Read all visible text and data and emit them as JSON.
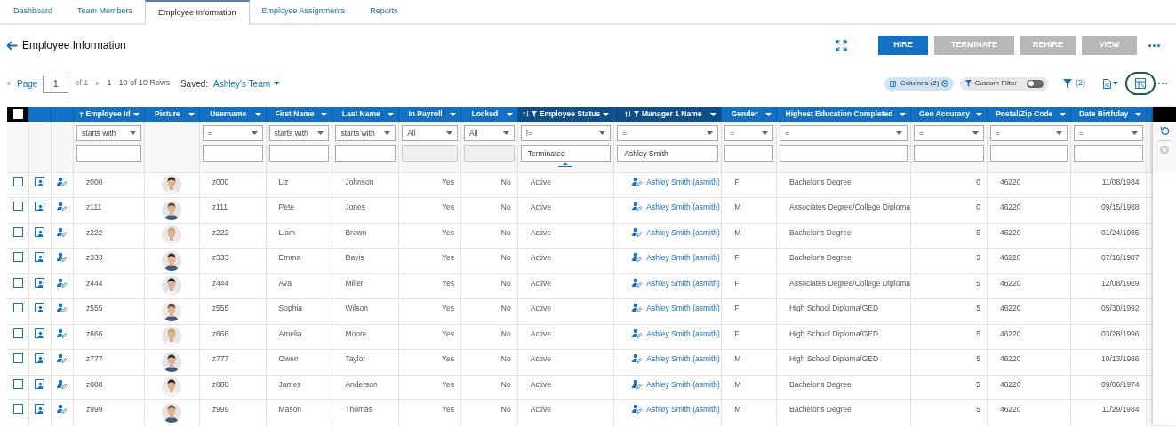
{
  "tabs": [
    {
      "label": "Dashboard",
      "selected": false
    },
    {
      "label": "Team Members",
      "selected": false
    },
    {
      "label": "Employee Information",
      "selected": true
    },
    {
      "label": "Employee Assignments",
      "selected": false
    },
    {
      "label": "Reports",
      "selected": false
    }
  ],
  "header": {
    "title": "Employee Information",
    "buttons": [
      {
        "label": "HIRE",
        "disabled": false
      },
      {
        "label": "TERMINATE",
        "disabled": true
      },
      {
        "label": "REHIRE",
        "disabled": true
      },
      {
        "label": "VIEW",
        "disabled": true
      }
    ]
  },
  "pager": {
    "page_label": "Page",
    "page": "1",
    "of": "of 1",
    "rows": "1 - 10 of 10 Rows",
    "saved_label": "Saved:",
    "saved": "Ashley's Team"
  },
  "chips": {
    "columns": "Columns (2)",
    "custom_filter": "Custom Filter",
    "custom_filter_on": false,
    "filter_count": "(2)"
  },
  "select_all_checked": false,
  "columns": [
    {
      "label": "Employee Id",
      "kind": "text",
      "sorted": true,
      "filtered": false,
      "filter": {
        "operator": "starts with",
        "disabled": false
      }
    },
    {
      "label": "Picture",
      "kind": "picture",
      "sorted": false,
      "filtered": false
    },
    {
      "label": "Username",
      "kind": "text",
      "sorted": false,
      "filtered": false,
      "filter": {
        "operator": "=",
        "disabled": false
      }
    },
    {
      "label": "First Name",
      "kind": "text",
      "sorted": false,
      "filtered": false,
      "filter": {
        "operator": "starts with",
        "disabled": false
      }
    },
    {
      "label": "Last Name",
      "kind": "text",
      "sorted": false,
      "filtered": false,
      "filter": {
        "operator": "starts with",
        "disabled": false
      }
    },
    {
      "label": "In Payroll",
      "kind": "number",
      "sorted": false,
      "filtered": false,
      "filter": {
        "operator": "All",
        "disabled": true
      }
    },
    {
      "label": "Locked",
      "kind": "number",
      "sorted": false,
      "filtered": false,
      "filter": {
        "operator": "All",
        "disabled": true
      }
    },
    {
      "label": "Employee Status",
      "kind": "text",
      "sorted": false,
      "filtered": true,
      "filter": {
        "operator": "!=",
        "value": "Terminated",
        "disabled": false
      }
    },
    {
      "label": "Manager 1 Name",
      "kind": "link",
      "sorted": false,
      "filtered": true,
      "filter": {
        "operator": "=",
        "value": "Ashley Smith",
        "disabled": false
      }
    },
    {
      "label": "Gender",
      "kind": "text",
      "sorted": false,
      "filtered": false,
      "filter": {
        "operator": "=",
        "disabled": false
      }
    },
    {
      "label": "Highest Education Completed",
      "kind": "text",
      "sorted": false,
      "filtered": false,
      "filter": {
        "operator": "=",
        "disabled": false
      }
    },
    {
      "label": "Geo Accuracy",
      "kind": "number",
      "sorted": false,
      "filtered": false,
      "filter": {
        "operator": "=",
        "disabled": false
      }
    },
    {
      "label": "Postal/Zip Code",
      "kind": "text",
      "sorted": false,
      "filtered": false,
      "filter": {
        "operator": "=",
        "disabled": false
      }
    },
    {
      "label": "Date Birthday",
      "kind": "number",
      "sorted": false,
      "filtered": false,
      "filter": {
        "operator": "=",
        "disabled": false
      }
    }
  ],
  "rows": [
    {
      "checked": false,
      "cells": [
        "z000",
        "z000",
        "Liz",
        "Johnson",
        "Yes",
        "No",
        "Active",
        "Ashley Smith (asmith)",
        "F",
        "Bachelor's Degree",
        "0",
        "46220",
        "11/08/1984"
      ]
    },
    {
      "checked": false,
      "cells": [
        "z111",
        "z111",
        "Pete",
        "Jones",
        "Yes",
        "No",
        "Active",
        "Ashley Smith (asmith)",
        "M",
        "Associates Degree/College Diploma",
        "0",
        "46220",
        "09/15/1988"
      ]
    },
    {
      "checked": false,
      "cells": [
        "z222",
        "z222",
        "Liam",
        "Brown",
        "Yes",
        "No",
        "Active",
        "Ashley Smith (asmith)",
        "M",
        "Bachelor's Degree",
        "5",
        "46220",
        "01/24/1985"
      ]
    },
    {
      "checked": false,
      "cells": [
        "z333",
        "z333",
        "Emma",
        "Davis",
        "Yes",
        "No",
        "Active",
        "Ashley Smith (asmith)",
        "F",
        "Bachelor's Degree",
        "5",
        "46220",
        "07/16/1987"
      ]
    },
    {
      "checked": false,
      "cells": [
        "z444",
        "z444",
        "Ava",
        "Miller",
        "Yes",
        "No",
        "Active",
        "Ashley Smith (asmith)",
        "F",
        "Associates Degree/College Diploma",
        "5",
        "46220",
        "12/08/1989"
      ]
    },
    {
      "checked": false,
      "cells": [
        "z555",
        "z555",
        "Sophia",
        "Wilson",
        "Yes",
        "No",
        "Active",
        "Ashley Smith (asmith)",
        "F",
        "High School Diploma/GED",
        "5",
        "46220",
        "05/30/1992"
      ]
    },
    {
      "checked": false,
      "cells": [
        "z666",
        "z666",
        "Amelia",
        "Moore",
        "Yes",
        "No",
        "Active",
        "Ashley Smith (asmith)",
        "F",
        "High School Diploma/GED",
        "5",
        "46220",
        "03/28/1996"
      ]
    },
    {
      "checked": false,
      "cells": [
        "z777",
        "z777",
        "Owen",
        "Taylor",
        "Yes",
        "No",
        "Active",
        "Ashley Smith (asmith)",
        "M",
        "High School Diploma/GED",
        "5",
        "46220",
        "10/13/1986"
      ]
    },
    {
      "checked": false,
      "cells": [
        "z888",
        "z888",
        "James",
        "Anderson",
        "Yes",
        "No",
        "Active",
        "Ashley Smith (asmith)",
        "M",
        "Bachelor's Degree",
        "5",
        "46220",
        "09/06/1974"
      ]
    },
    {
      "checked": false,
      "cells": [
        "z999",
        "z999",
        "Mason",
        "Thomas",
        "Yes",
        "No",
        "Active",
        "Ashley Smith (asmith)",
        "M",
        "Bachelor's Degree",
        "5",
        "46220",
        "11/29/1984"
      ]
    }
  ]
}
